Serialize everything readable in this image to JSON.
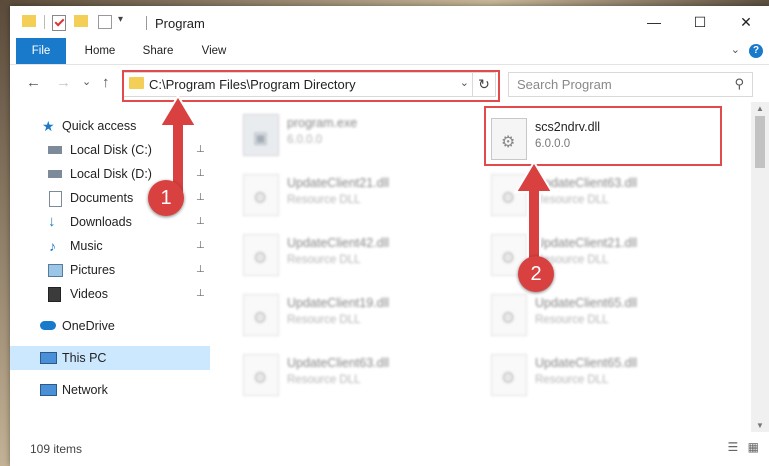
{
  "window": {
    "title": "Program",
    "controls": {
      "minimize": "—",
      "maximize": "☐",
      "close": "✕"
    }
  },
  "ribbon": {
    "tabs": [
      "File",
      "Home",
      "Share",
      "View"
    ],
    "expand_glyph": "⌄",
    "help_glyph": "?"
  },
  "addressbar": {
    "back": "←",
    "forward": "→",
    "recent": "⌄",
    "up": "↑",
    "path": "C:\\Program Files\\Program Directory",
    "dropdown": "⌄",
    "refresh": "↻"
  },
  "search": {
    "placeholder": "Search Program",
    "icon": "⚲"
  },
  "nav": {
    "items": [
      {
        "label": "Quick access",
        "icon": "star-icon",
        "color": "#1979ca"
      },
      {
        "label": "Local Disk (C:)",
        "icon": "drive-icon",
        "pinned": true
      },
      {
        "label": "Local Disk (D:)",
        "icon": "drive-icon",
        "pinned": true
      },
      {
        "label": "Documents",
        "icon": "documents-icon",
        "pinned": true
      },
      {
        "label": "Downloads",
        "icon": "downloads-icon",
        "pinned": true
      },
      {
        "label": "Music",
        "icon": "music-icon",
        "pinned": true
      },
      {
        "label": "Pictures",
        "icon": "pictures-icon",
        "pinned": true
      },
      {
        "label": "Videos",
        "icon": "videos-icon",
        "pinned": true
      },
      {
        "label": "OneDrive",
        "icon": "cloud-icon"
      },
      {
        "label": "This PC",
        "icon": "computer-icon",
        "selected": true
      },
      {
        "label": "Network",
        "icon": "network-icon"
      }
    ],
    "pin_glyph": "📌"
  },
  "files": [
    {
      "name": "program.exe",
      "desc": "6.0.0.0",
      "blurred": true,
      "kind": "exe"
    },
    {
      "name": "scs2ndrv.dll",
      "desc": "6.0.0.0",
      "blurred": false,
      "kind": "dll"
    },
    {
      "name": "UpdateClient21.dll",
      "desc": "Resource DLL",
      "blurred": true,
      "kind": "dll"
    },
    {
      "name": "UpdateClient63.dll",
      "desc": "Resource DLL",
      "blurred": true,
      "kind": "dll"
    },
    {
      "name": "UpdateClient42.dll",
      "desc": "Resource DLL",
      "blurred": true,
      "kind": "dll"
    },
    {
      "name": "UpdateClient21.dll",
      "desc": "Resource DLL",
      "blurred": true,
      "kind": "dll"
    },
    {
      "name": "UpdateClient19.dll",
      "desc": "Resource DLL",
      "blurred": true,
      "kind": "dll"
    },
    {
      "name": "UpdateClient65.dll",
      "desc": "Resource DLL",
      "blurred": true,
      "kind": "dll"
    },
    {
      "name": "UpdateClient63.dll",
      "desc": "Resource DLL",
      "blurred": true,
      "kind": "dll"
    },
    {
      "name": "UpdateClient65.dll",
      "desc": "Resource DLL",
      "blurred": true,
      "kind": "dll"
    }
  ],
  "status": {
    "count": "109 items"
  },
  "annotations": {
    "step1": "1",
    "step2": "2",
    "color": "#d94040"
  }
}
